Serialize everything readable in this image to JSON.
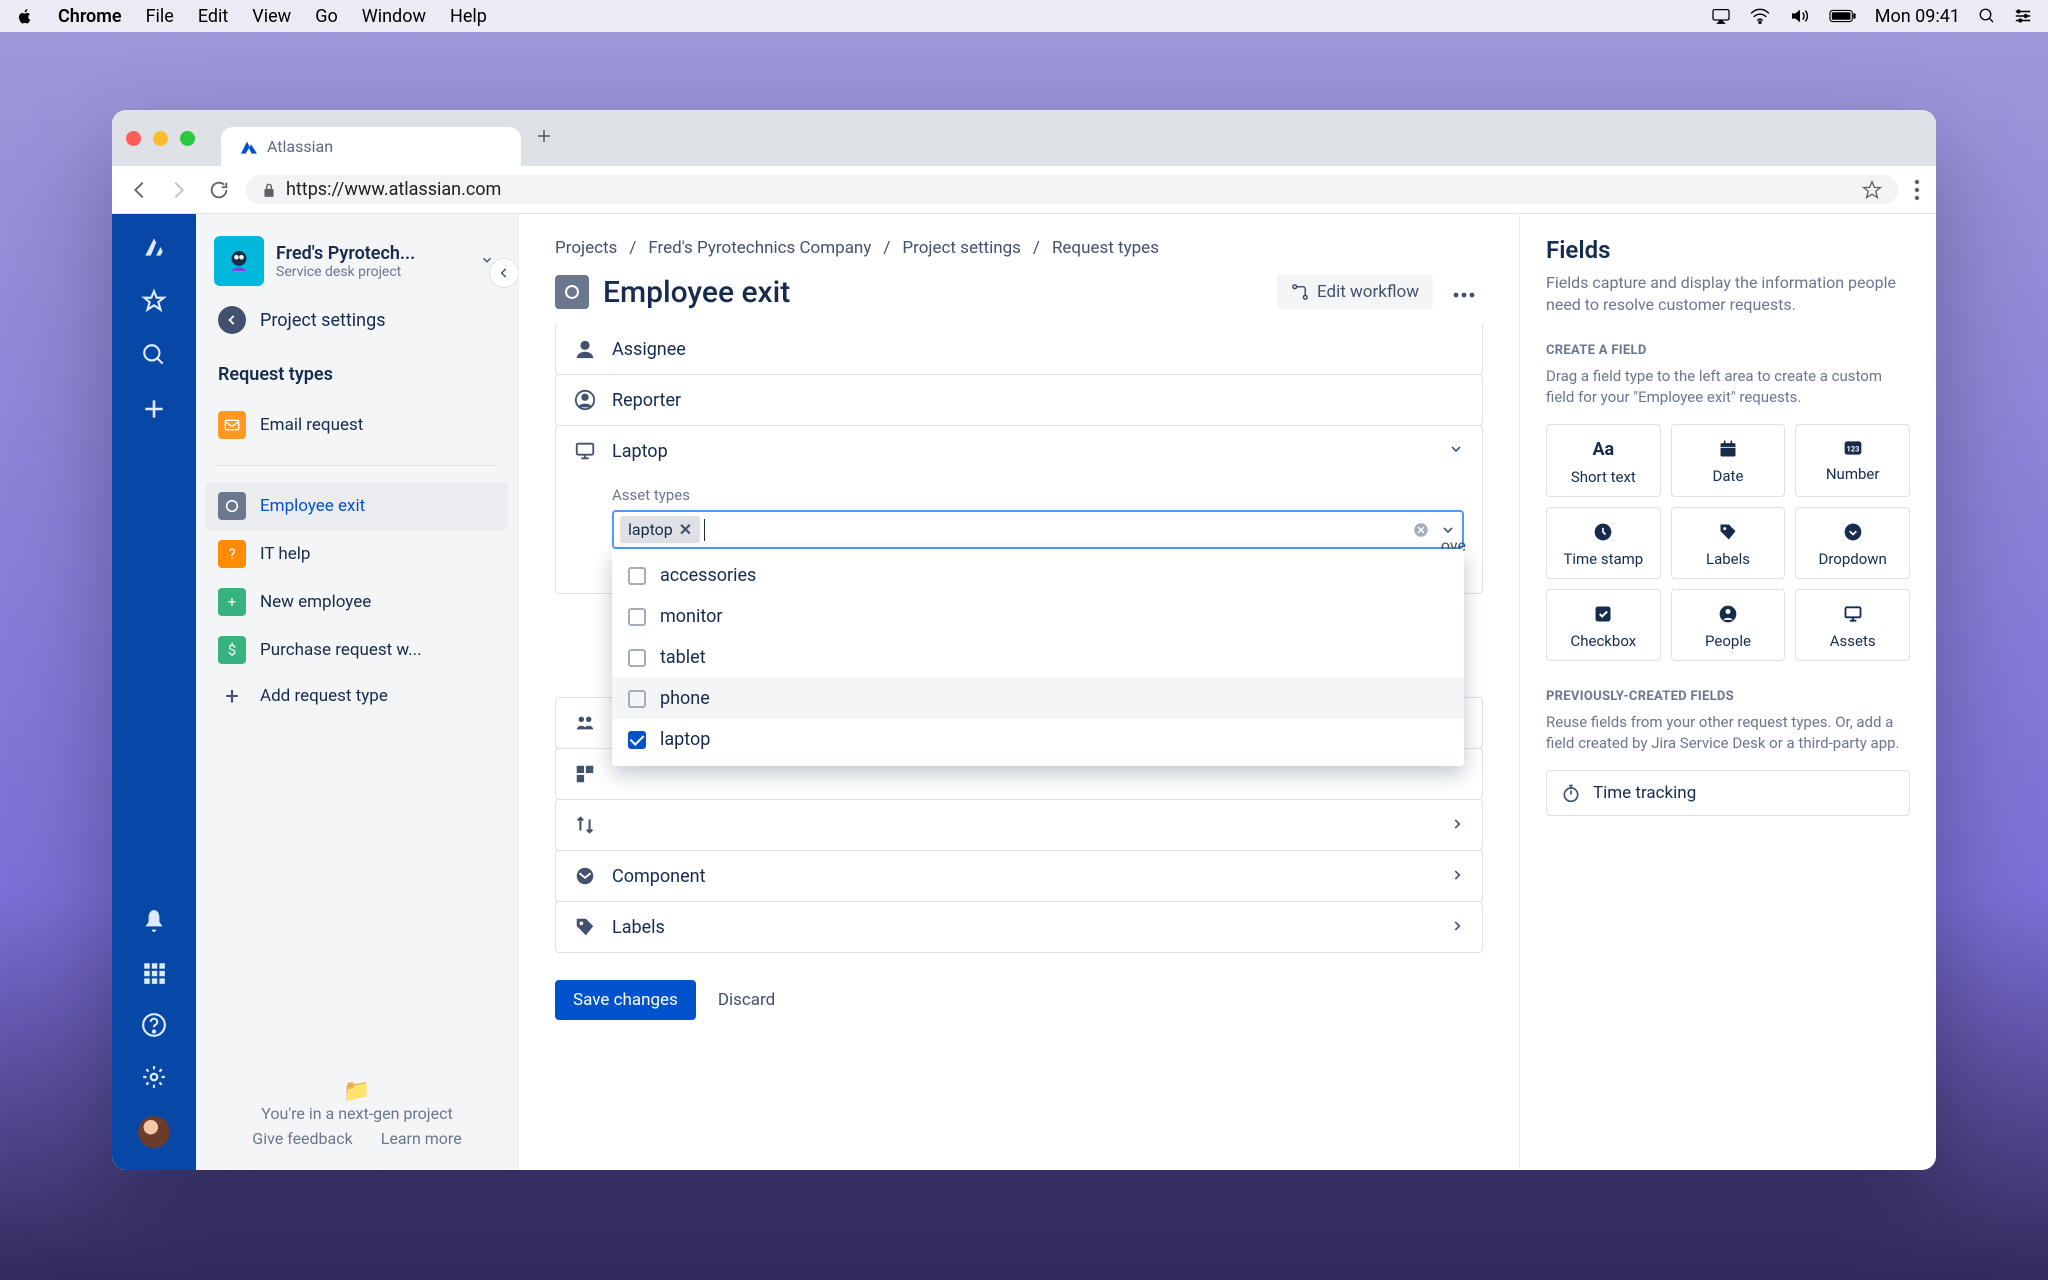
{
  "menubar": {
    "app": "Chrome",
    "items": [
      "File",
      "Edit",
      "View",
      "Go",
      "Window",
      "Help"
    ],
    "clock": "Mon 09:41"
  },
  "browser": {
    "tab_title": "Atlassian",
    "url": "https://www.atlassian.com"
  },
  "project": {
    "name": "Fred's Pyrotech...",
    "subtitle": "Service desk project",
    "back_link": "Project settings"
  },
  "sidebar": {
    "section": "Request types",
    "email_request": "Email request",
    "items": [
      {
        "label": "Employee exit",
        "active": true,
        "icon": "exit"
      },
      {
        "label": "IT help",
        "active": false,
        "icon": "it"
      },
      {
        "label": "New employee",
        "active": false,
        "icon": "new"
      },
      {
        "label": "Purchase request w...",
        "active": false,
        "icon": "purch"
      }
    ],
    "add_label": "Add request type",
    "footer_line": "You're in a next-gen project",
    "footer_feedback": "Give feedback",
    "footer_learn": "Learn more"
  },
  "breadcrumbs": [
    "Projects",
    "Fred's Pyrotechnics Company",
    "Project settings",
    "Request types"
  ],
  "page": {
    "title": "Employee exit",
    "edit_workflow": "Edit workflow"
  },
  "fields": {
    "assignee": "Assignee",
    "reporter": "Reporter",
    "laptop": "Laptop",
    "asset_types_label": "Asset types",
    "chip_value": "laptop",
    "options": [
      {
        "label": "accessories",
        "checked": false
      },
      {
        "label": "monitor",
        "checked": false
      },
      {
        "label": "tablet",
        "checked": false
      },
      {
        "label": "phone",
        "checked": false,
        "hover": true
      },
      {
        "label": "laptop",
        "checked": true
      }
    ],
    "remove": "...ove",
    "component": "Component",
    "labels": "Labels"
  },
  "buttons": {
    "save": "Save changes",
    "discard": "Discard"
  },
  "rpanel": {
    "title": "Fields",
    "desc": "Fields capture and display the information people need to resolve customer requests.",
    "create_head": "CREATE A FIELD",
    "create_sub": "Drag a field type to the left area to create a custom field for your \"Employee exit\" requests.",
    "types": [
      "Short text",
      "Date",
      "Number",
      "Time stamp",
      "Labels",
      "Dropdown",
      "Checkbox",
      "People",
      "Assets"
    ],
    "prev_head": "PREVIOUSLY-CREATED FIELDS",
    "prev_sub": "Reuse fields from your other request types. Or, add a field created by Jira Service Desk or a third-party app.",
    "time_tracking": "Time tracking"
  }
}
